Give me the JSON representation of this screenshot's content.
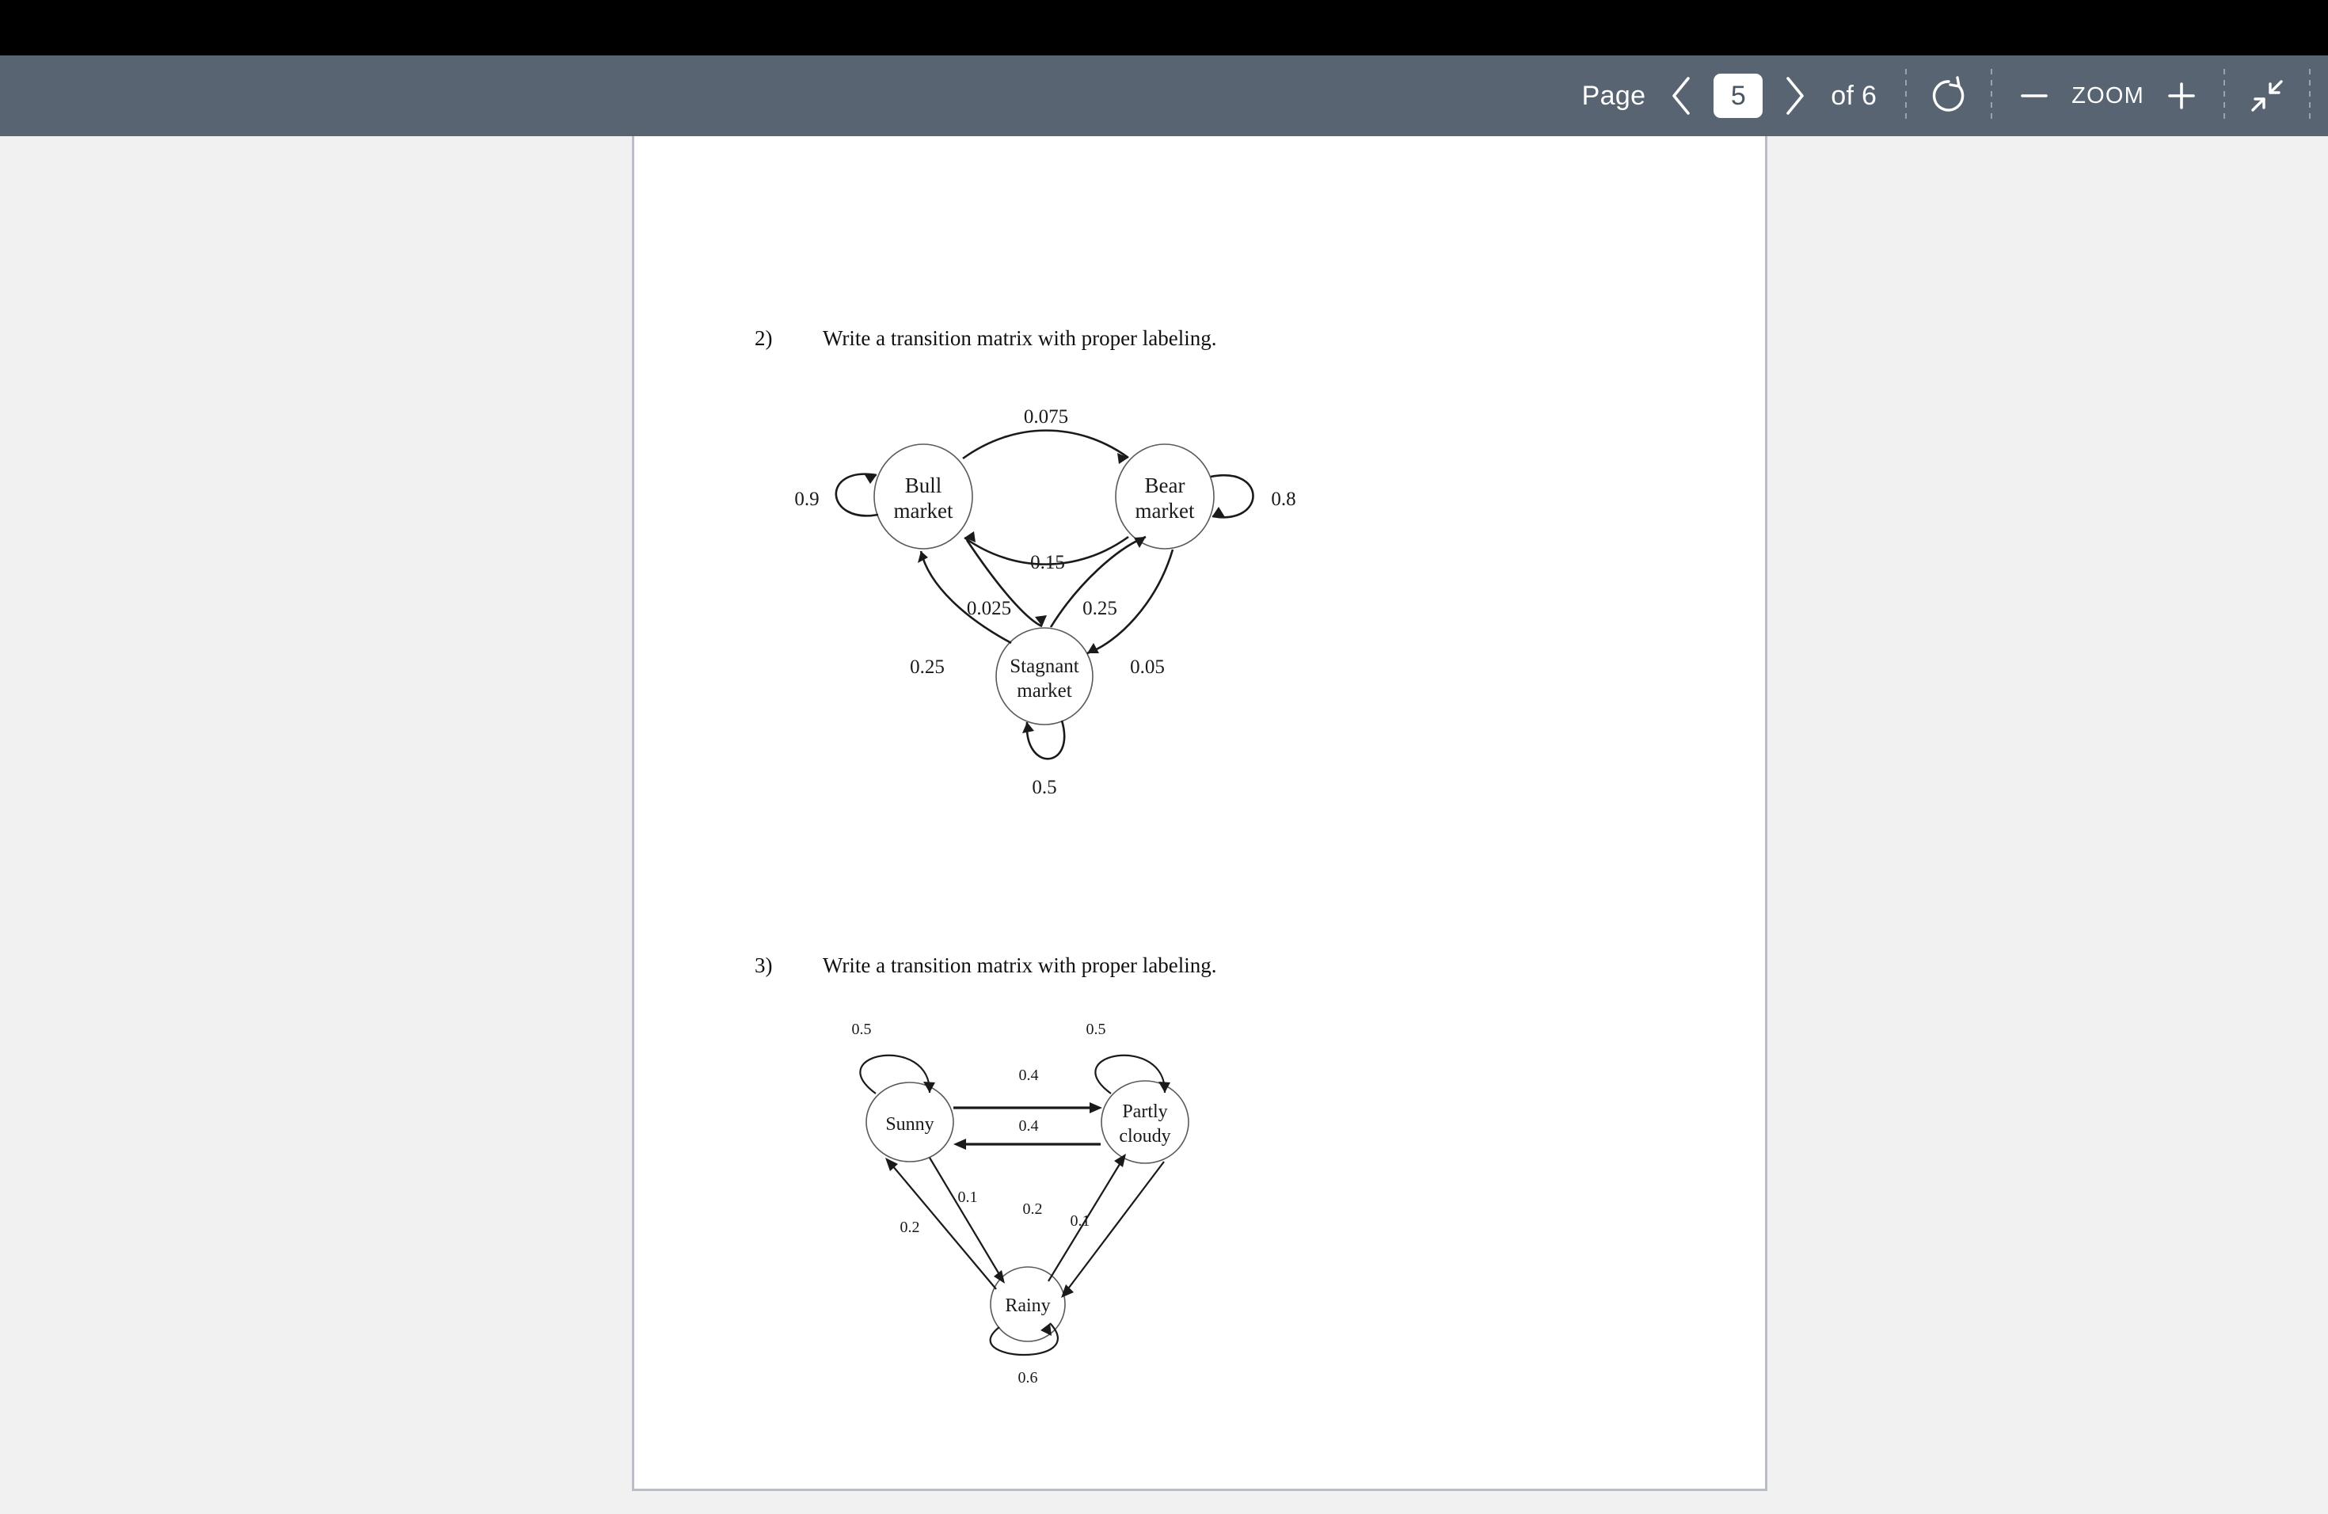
{
  "toolbar": {
    "page_label": "Page",
    "prev_icon": "chevron-left-icon",
    "page_value": "5",
    "next_icon": "chevron-right-icon",
    "of_label": "of 6",
    "rotate_icon": "rotate-icon",
    "zoom_out_icon": "minus-icon",
    "zoom_label": "ZOOM",
    "zoom_in_icon": "plus-icon",
    "exit_fullscreen_icon": "exit-fullscreen-icon",
    "background_color": "#586471",
    "text_color": "#ffffff"
  },
  "document": {
    "background_color": "#f1f1f1",
    "page_color": "#ffffff",
    "questions": [
      {
        "number": "2)",
        "text": "Write a transition matrix with proper labeling."
      },
      {
        "number": "3)",
        "text": "Write a transition matrix with proper labeling."
      }
    ]
  },
  "figures": [
    {
      "id": "market-markov-chain",
      "nodes": [
        {
          "id": "bull",
          "line1": "Bull",
          "line2": "market"
        },
        {
          "id": "bear",
          "line1": "Bear",
          "line2": "market"
        },
        {
          "id": "stagnant",
          "line1": "Stagnant",
          "line2": "market"
        }
      ],
      "edges": [
        {
          "from": "bull",
          "to": "bull",
          "label": "0.9"
        },
        {
          "from": "bull",
          "to": "bear",
          "label": "0.075"
        },
        {
          "from": "bear",
          "to": "bull",
          "label": "0.15"
        },
        {
          "from": "bear",
          "to": "bear",
          "label": "0.8"
        },
        {
          "from": "bull",
          "to": "stagnant",
          "label": "0.025"
        },
        {
          "from": "stagnant",
          "to": "bull",
          "label": "0.25"
        },
        {
          "from": "bear",
          "to": "stagnant",
          "label": "0.05"
        },
        {
          "from": "stagnant",
          "to": "bear",
          "label": "0.25"
        },
        {
          "from": "stagnant",
          "to": "stagnant",
          "label": "0.5"
        }
      ]
    },
    {
      "id": "weather-markov-chain",
      "nodes": [
        {
          "id": "sunny",
          "line1": "Sunny",
          "line2": ""
        },
        {
          "id": "partly",
          "line1": "Partly",
          "line2": "cloudy"
        },
        {
          "id": "rainy",
          "line1": "Rainy",
          "line2": ""
        }
      ],
      "edges": [
        {
          "from": "sunny",
          "to": "sunny",
          "label": "0.5"
        },
        {
          "from": "sunny",
          "to": "partly",
          "label": "0.4"
        },
        {
          "from": "partly",
          "to": "sunny",
          "label": "0.4"
        },
        {
          "from": "partly",
          "to": "partly",
          "label": "0.5"
        },
        {
          "from": "sunny",
          "to": "rainy",
          "label": "0.1"
        },
        {
          "from": "rainy",
          "to": "sunny",
          "label": "0.2"
        },
        {
          "from": "partly",
          "to": "rainy",
          "label": "0.1"
        },
        {
          "from": "rainy",
          "to": "partly",
          "label": "0.2"
        },
        {
          "from": "rainy",
          "to": "rainy",
          "label": "0.6"
        }
      ]
    }
  ]
}
